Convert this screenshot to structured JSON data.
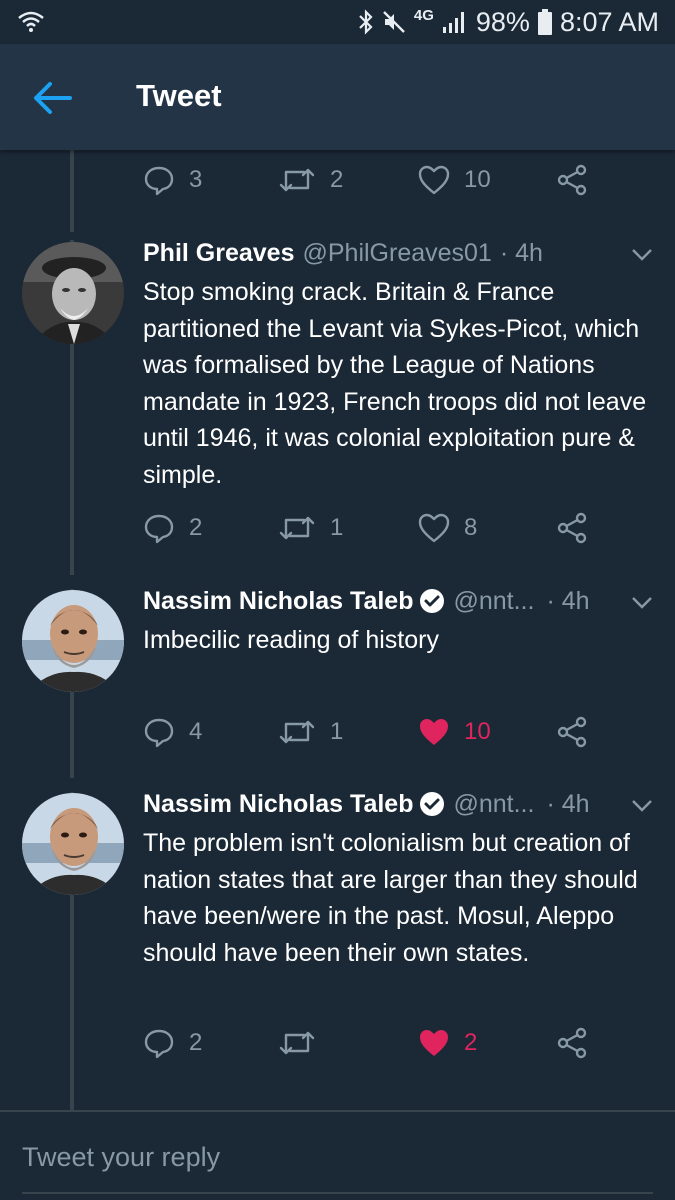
{
  "status_bar": {
    "network": "4G",
    "battery": "98%",
    "time": "8:07 AM"
  },
  "header": {
    "title": "Tweet",
    "back_icon": "arrow-left-icon"
  },
  "colors": {
    "background": "#1b2836",
    "header": "#243447",
    "accent": "#1da1f2",
    "like": "#e0245e",
    "secondary_text": "#8899a6"
  },
  "parent_actions": {
    "replies": "3",
    "retweets": "2",
    "likes": "10"
  },
  "tweets": [
    {
      "name": "Phil Greaves",
      "handle": "@PhilGreaves01",
      "time": "· 4h",
      "verified": false,
      "text": "Stop smoking crack. Britain & France partitioned the Levant via Sykes-Picot, which was formalised by the League of Nations mandate in 1923, French troops did not leave until 1946, it was colonial exploitation pure & simple.",
      "replies": "2",
      "retweets": "1",
      "likes": "8",
      "liked": false
    },
    {
      "name": "Nassim Nicholas Taleb",
      "handle": "@nnt...",
      "time": "· 4h",
      "verified": true,
      "text": "Imbecilic reading of history",
      "replies": "4",
      "retweets": "1",
      "likes": "10",
      "liked": true
    },
    {
      "name": "Nassim Nicholas Taleb",
      "handle": "@nnt...",
      "time": "· 4h",
      "verified": true,
      "text": "The problem isn't colonialism but creation of nation states that are larger than they should have been/were in the past. Mosul, Aleppo should have been their own states.",
      "replies": "2",
      "retweets": "",
      "likes": "2",
      "liked": true
    }
  ],
  "reply_bar": {
    "placeholder": "Tweet your reply"
  }
}
